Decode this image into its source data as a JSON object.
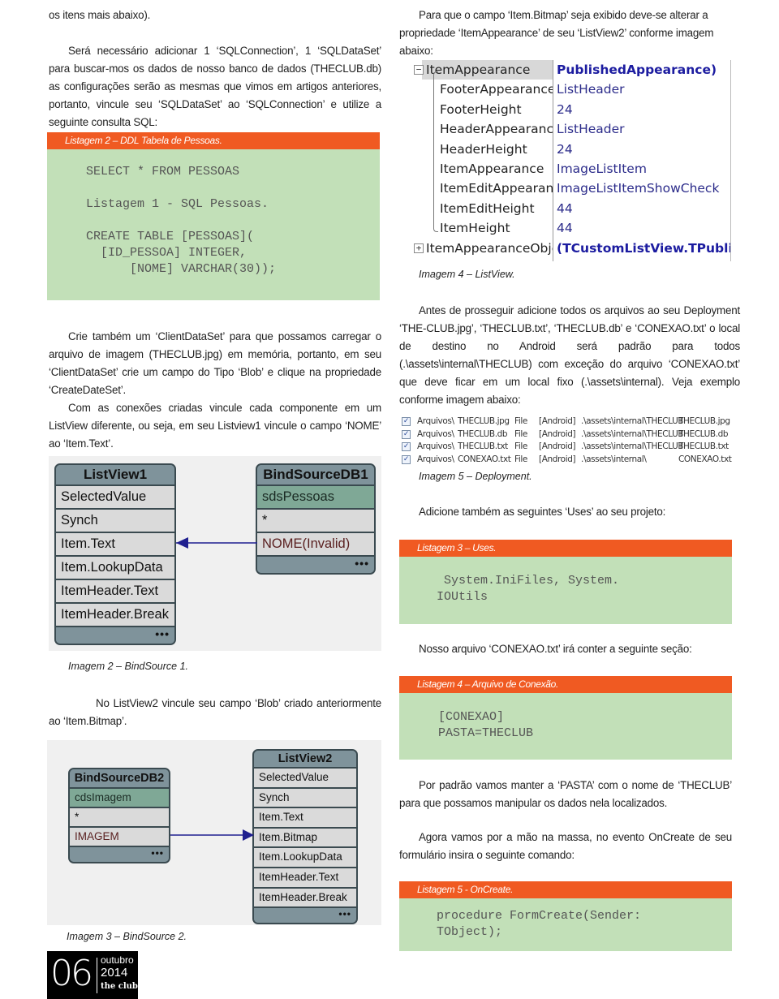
{
  "left": {
    "para0": "os itens mais abaixo).",
    "para1": "Será necessário adicionar 1 ‘SQLConnection’, 1 ‘SQLDataSet’ para buscar-mos os dados de nosso banco de dados (THECLUB.db) as configurações serão as mesmas que vimos em artigos anteriores, portanto, vincule seu ‘SQLDataSet’ ao ‘SQLConnection’ e utilize a seguinte consulta SQL:",
    "listing2": {
      "header": "Listagem 2 – DDL Tabela de Pessoas.",
      "code": "SELECT * FROM PESSOAS\n\nListagem 1 - SQL Pessoas.\n\nCREATE TABLE [PESSOAS](\n  [ID_PESSOA] INTEGER,\n      [NOME] VARCHAR(30));"
    },
    "para2": "Crie também um ‘ClientDataSet’ para que possamos carregar o arquivo de imagem (THECLUB.jpg) em memória, portanto, em seu ‘ClientDataSet’ crie um campo do Tipo ‘Blob’ e clique na propriedade ‘CreateDateSet’.",
    "para3": "Com as conexões criadas vincule cada componente em um ListView diferente, ou seja, em seu Listview1 vincule o campo ‘NOME’ ao ‘Item.Text’.",
    "diagram1": {
      "listview": {
        "title": "ListView1",
        "rows": [
          "SelectedValue",
          "Synch",
          "Item.Text",
          "Item.LookupData",
          "ItemHeader.Text",
          "ItemHeader.Break"
        ],
        "footer": "•••"
      },
      "bindsource": {
        "title": "BindSourceDB1",
        "source": "sdsPessoas",
        "rows": [
          "*",
          "NOME(Invalid)"
        ],
        "footer": "•••"
      },
      "link_from": "NOME(Invalid)",
      "link_to": "Item.Text"
    },
    "caption2": "Imagem 2 – BindSource 1.",
    "para4": "No ListView2 vincule seu campo ‘Blob’ criado anteriormente ao ‘Item.Bitmap’.",
    "diagram2": {
      "bindsource": {
        "title": "BindSourceDB2",
        "source": "cdsImagem",
        "rows": [
          "*",
          "IMAGEM"
        ],
        "footer": "•••"
      },
      "listview": {
        "title": "ListView2",
        "rows": [
          "SelectedValue",
          "Synch",
          "Item.Text",
          "Item.Bitmap",
          "Item.LookupData",
          "ItemHeader.Text",
          "ItemHeader.Break"
        ],
        "footer": "•••"
      },
      "link_from": "IMAGEM",
      "link_to": "Item.Bitmap"
    },
    "caption3": "Imagem 3 – BindSource 2."
  },
  "right": {
    "para1": "Para que o campo ‘Item.Bitmap’ seja exibido deve-se alterar a propriedade ‘ItemAppearance’ de seu ‘ListView2’ conforme imagem abaixo:",
    "propgrid": {
      "rows": [
        {
          "name": "ItemAppearance",
          "value": "PublishedAppearance)",
          "expander": "−",
          "bold": true,
          "level": 0
        },
        {
          "name": "FooterAppearance",
          "value": "ListHeader",
          "level": 1
        },
        {
          "name": "FooterHeight",
          "value": "24",
          "level": 1
        },
        {
          "name": "HeaderAppearance",
          "value": "ListHeader",
          "level": 1
        },
        {
          "name": "HeaderHeight",
          "value": "24",
          "level": 1
        },
        {
          "name": "ItemAppearance",
          "value": "ImageListItem",
          "level": 1
        },
        {
          "name": "ItemEditAppearance",
          "value": "ImageListItemShowCheck",
          "level": 1
        },
        {
          "name": "ItemEditHeight",
          "value": "44",
          "level": 1
        },
        {
          "name": "ItemHeight",
          "value": "44",
          "level": 1
        },
        {
          "name": "ItemAppearanceObjects",
          "value": "(TCustomListView.TPublished",
          "expander": "+",
          "bold": true,
          "level": 0
        }
      ]
    },
    "caption4": "Imagem 4 – ListView.",
    "para2": "Antes de prosseguir adicione todos os arquivos ao seu Deployment ‘THE-CLUB.jpg’, ‘THECLUB.txt’, ‘THECLUB.db’ e ‘CONEXAO.txt’ o local de destino no Android será padrão para todos (.\\assets\\internal\\THECLUB) com exceção do arquivo ‘CONEXAO.txt’ que deve ficar em um local fixo (.\\assets\\internal). Veja exemplo conforme imagem abaixo:",
    "deployment": {
      "rows": [
        {
          "checked": true,
          "folder": "Arquivos\\",
          "file": "THECLUB.jpg",
          "type": "File",
          "platform": "[Android]",
          "remote_path": ".\\assets\\internal\\THECLUB",
          "remote_name": "THECLUB.jpg"
        },
        {
          "checked": true,
          "folder": "Arquivos\\",
          "file": "THECLUB.db",
          "type": "File",
          "platform": "[Android]",
          "remote_path": ".\\assets\\internal\\THECLUB",
          "remote_name": "THECLUB.db"
        },
        {
          "checked": true,
          "folder": "Arquivos\\",
          "file": "THECLUB.txt",
          "type": "File",
          "platform": "[Android]",
          "remote_path": ".\\assets\\internal\\THECLUB",
          "remote_name": "THECLUB.txt"
        },
        {
          "checked": true,
          "folder": "Arquivos\\",
          "file": "CONEXAO.txt",
          "type": "File",
          "platform": "[Android]",
          "remote_path": ".\\assets\\internal\\",
          "remote_name": "CONEXAO.txt"
        }
      ]
    },
    "caption5": "Imagem 5 – Deployment.",
    "para3": "Adicione também as seguintes ‘Uses’ ao seu projeto:",
    "listing3": {
      "header": "Listagem 3 – Uses.",
      "code": " System.IniFiles, System.\nIOUtils"
    },
    "para4": "Nosso arquivo ‘CONEXAO.txt’ irá conter a seguinte seção:",
    "listing4": {
      "header": "Listagem 4 – Arquivo de Conexão.",
      "code": "[CONEXAO]\nPASTA=THECLUB"
    },
    "para5": "Por padrão vamos manter a ‘PASTA’ com o nome de ‘THECLUB’ para que possamos manipular os dados nela localizados.",
    "para6": "Agora vamos por a mão na massa, no evento OnCreate de seu formulário insira o seguinte comando:",
    "listing5": {
      "header": "Listagem 5 - OnCreate.",
      "code": "procedure FormCreate(Sender:\nTObject);"
    }
  },
  "footer": {
    "page_number": "06",
    "month": "outubro",
    "year": "2014",
    "brand": "the club"
  },
  "colors": {
    "listing_header": "#f05a22",
    "listing_body": "#c2e0b8",
    "link_arrow": "#1f1f8f",
    "box_title": "#7f939b",
    "box_source": "#7fa896"
  }
}
